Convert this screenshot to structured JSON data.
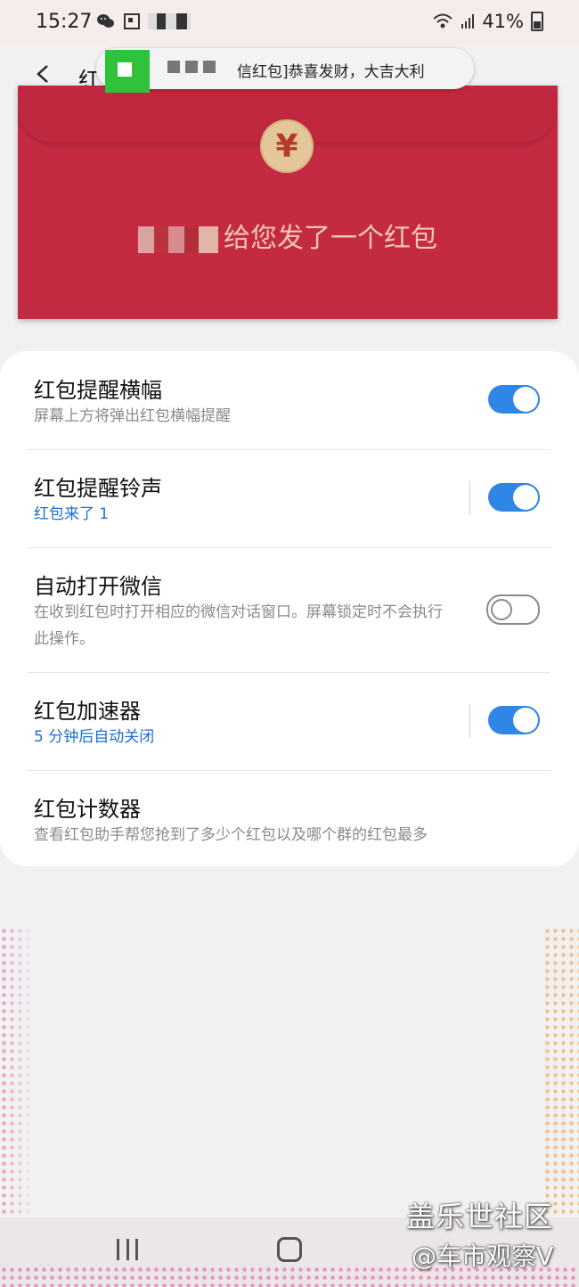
{
  "status_bar": {
    "time": "15:27",
    "battery": "41%"
  },
  "app_bar": {
    "title": "红"
  },
  "toast": {
    "message": "信红包]恭喜发财，大吉大利"
  },
  "envelope": {
    "coin_symbol": "¥",
    "message": "给您发了一个红包"
  },
  "settings": [
    {
      "title": "红包提醒横幅",
      "subtitle": "屏幕上方将弹出红包横幅提醒",
      "toggle": "on"
    },
    {
      "title": "红包提醒铃声",
      "subtitle": "红包来了 1",
      "toggle": "on"
    },
    {
      "title": "自动打开微信",
      "subtitle": "在收到红包时打开相应的微信对话窗口。屏幕锁定时不会执行此操作。",
      "toggle": "off"
    },
    {
      "title": "红包加速器",
      "subtitle": "5 分钟后自动关闭",
      "toggle": "on"
    },
    {
      "title": "红包计数器",
      "subtitle": "查看红包助手帮您抢到了多少个红包以及哪个群的红包最多"
    }
  ],
  "watermark": {
    "line1": "盖乐世社区",
    "line2": "@车市观察V"
  },
  "colors": {
    "accent_blue": "#2e86e6",
    "envelope_red": "#c52a43",
    "coin_gold": "#e3c69a"
  },
  "icons": [
    "wechat-icon",
    "screenshot-icon",
    "wifi-icon",
    "signal-icon",
    "battery-icon",
    "back-arrow-icon",
    "recent-apps-icon",
    "home-icon"
  ]
}
